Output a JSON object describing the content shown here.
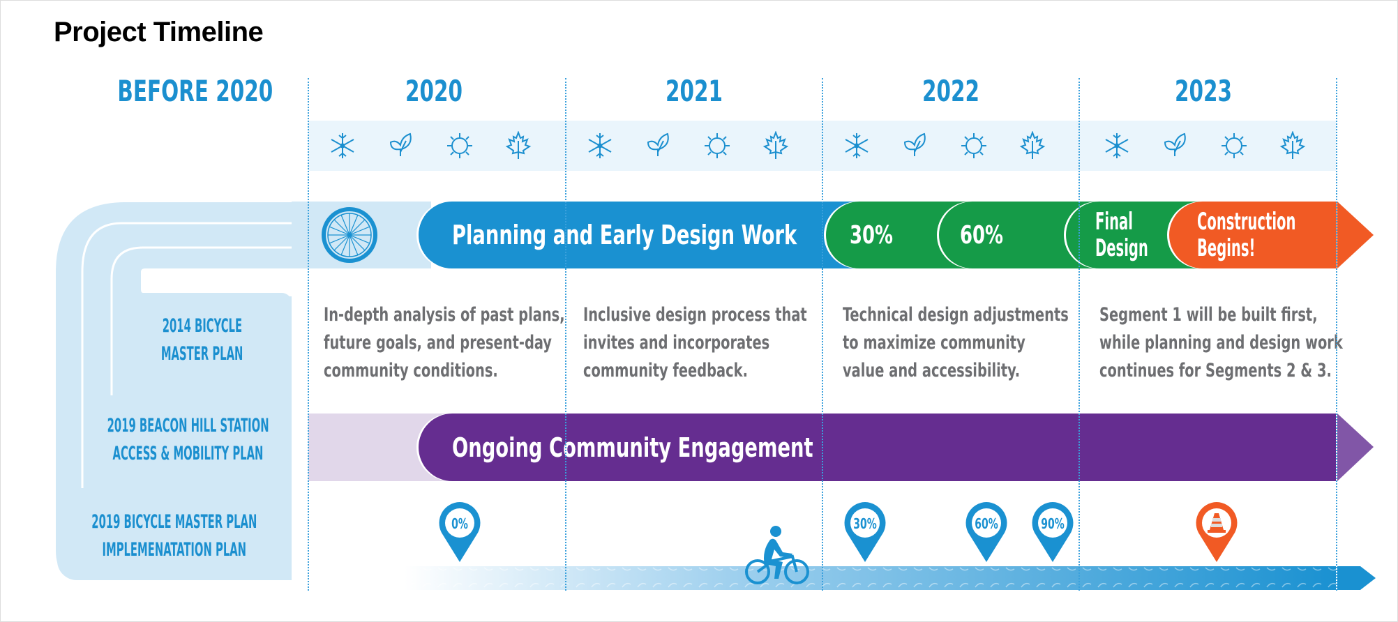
{
  "title": "Project Timeline",
  "columns": [
    {
      "label": "BEFORE 2020"
    },
    {
      "label": "2020"
    },
    {
      "label": "2021"
    },
    {
      "label": "2022"
    },
    {
      "label": "2023"
    }
  ],
  "seasons": [
    "winter-snowflake-icon",
    "spring-leaf-icon",
    "summer-sun-icon",
    "fall-maple-leaf-icon"
  ],
  "prior_plans": [
    {
      "lines": [
        "2014 BICYCLE",
        "MASTER PLAN"
      ]
    },
    {
      "lines": [
        "2019 BEACON HILL STATION",
        "ACCESS & MOBILITY PLAN"
      ]
    },
    {
      "lines": [
        "2019 BICYCLE MASTER PLAN",
        "IMPLEMENATATION PLAN"
      ]
    }
  ],
  "phases": [
    {
      "label": "Planning and Early Design Work",
      "color": "#1a91d1"
    },
    {
      "label": "30%",
      "color": "#159b48"
    },
    {
      "label": "60%",
      "color": "#159b48"
    },
    {
      "label_lines": [
        "Final",
        "Design"
      ],
      "color": "#159b48"
    },
    {
      "label_lines": [
        "Construction",
        "Begins!"
      ],
      "color": "#f15a24"
    }
  ],
  "descriptions": [
    {
      "lines": [
        "In-depth analysis of past plans,",
        "future goals, and present-day",
        "community conditions."
      ]
    },
    {
      "lines": [
        "Inclusive design process that",
        "invites and incorporates",
        "community feedback."
      ]
    },
    {
      "lines": [
        "Technical design adjustments",
        "to maximize community",
        "value and accessibility."
      ]
    },
    {
      "lines": [
        "Segment 1 will be built first,",
        "while planning and design work",
        "continues for Segments 2 & 3."
      ]
    }
  ],
  "engagement": {
    "label": "Ongoing Community Engagement",
    "color": "#652d90"
  },
  "milestones": [
    {
      "label": "0%",
      "color": "#1a91d1"
    },
    {
      "label": "30%",
      "color": "#1a91d1"
    },
    {
      "label": "60%",
      "color": "#1a91d1"
    },
    {
      "label": "90%",
      "color": "#1a91d1"
    },
    {
      "icon": "traffic-cone-icon",
      "color": "#f15a24"
    }
  ],
  "colors": {
    "accent_blue": "#1b8fcf",
    "light_blue": "#d1e8f6",
    "green": "#159b48",
    "orange": "#f15a24",
    "purple": "#652d90",
    "light_purple": "#e1d7ea",
    "text_gray": "#6d6e71"
  }
}
